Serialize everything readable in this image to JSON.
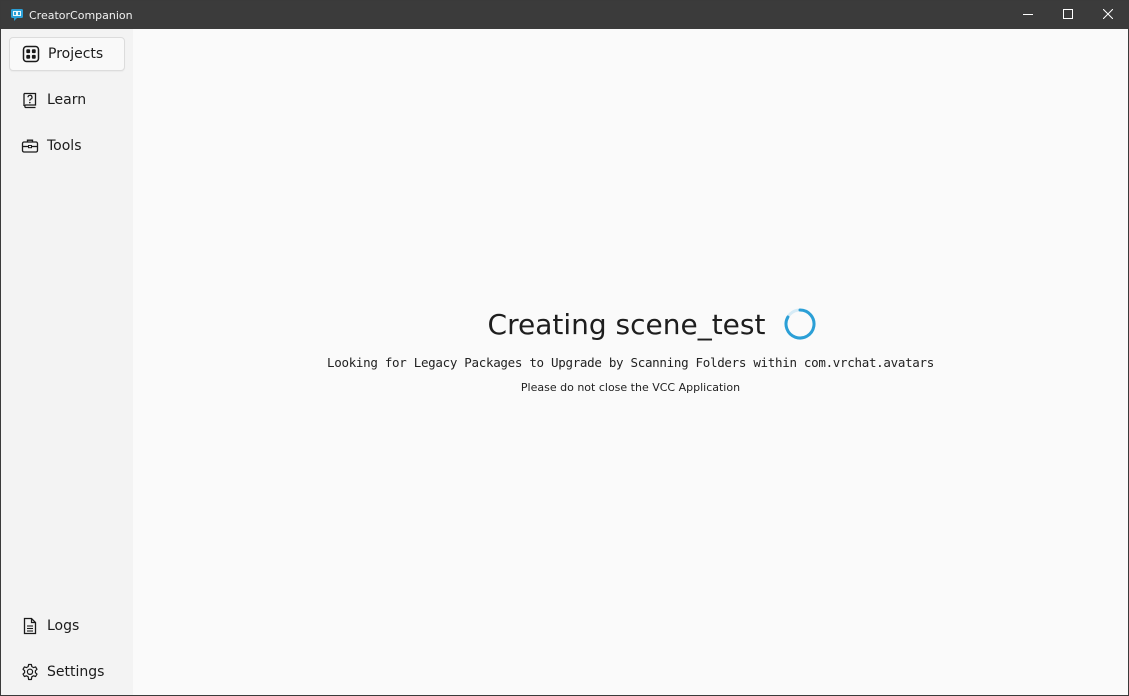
{
  "window": {
    "title": "CreatorCompanion",
    "controls": [
      "minimize-icon",
      "maximize-icon",
      "close-icon"
    ]
  },
  "sidebar": {
    "items": [
      {
        "label": "Projects",
        "icon": "grid-icon",
        "active": true
      },
      {
        "label": "Learn",
        "icon": "question-book-icon",
        "active": false
      },
      {
        "label": "Tools",
        "icon": "toolbox-icon",
        "active": false
      }
    ],
    "bottom_items": [
      {
        "label": "Logs",
        "icon": "document-icon"
      },
      {
        "label": "Settings",
        "icon": "gear-icon"
      }
    ]
  },
  "main": {
    "heading": "Creating scene_test",
    "status": "Looking for Legacy Packages to Upgrade by Scanning Folders within com.vrchat.avatars",
    "warning": "Please do not close the VCC Application"
  },
  "colors": {
    "titlebar": "#3b3b3b",
    "sidebar": "#f3f3f3",
    "content": "#fafafa",
    "accent": "#2b9fd6"
  }
}
